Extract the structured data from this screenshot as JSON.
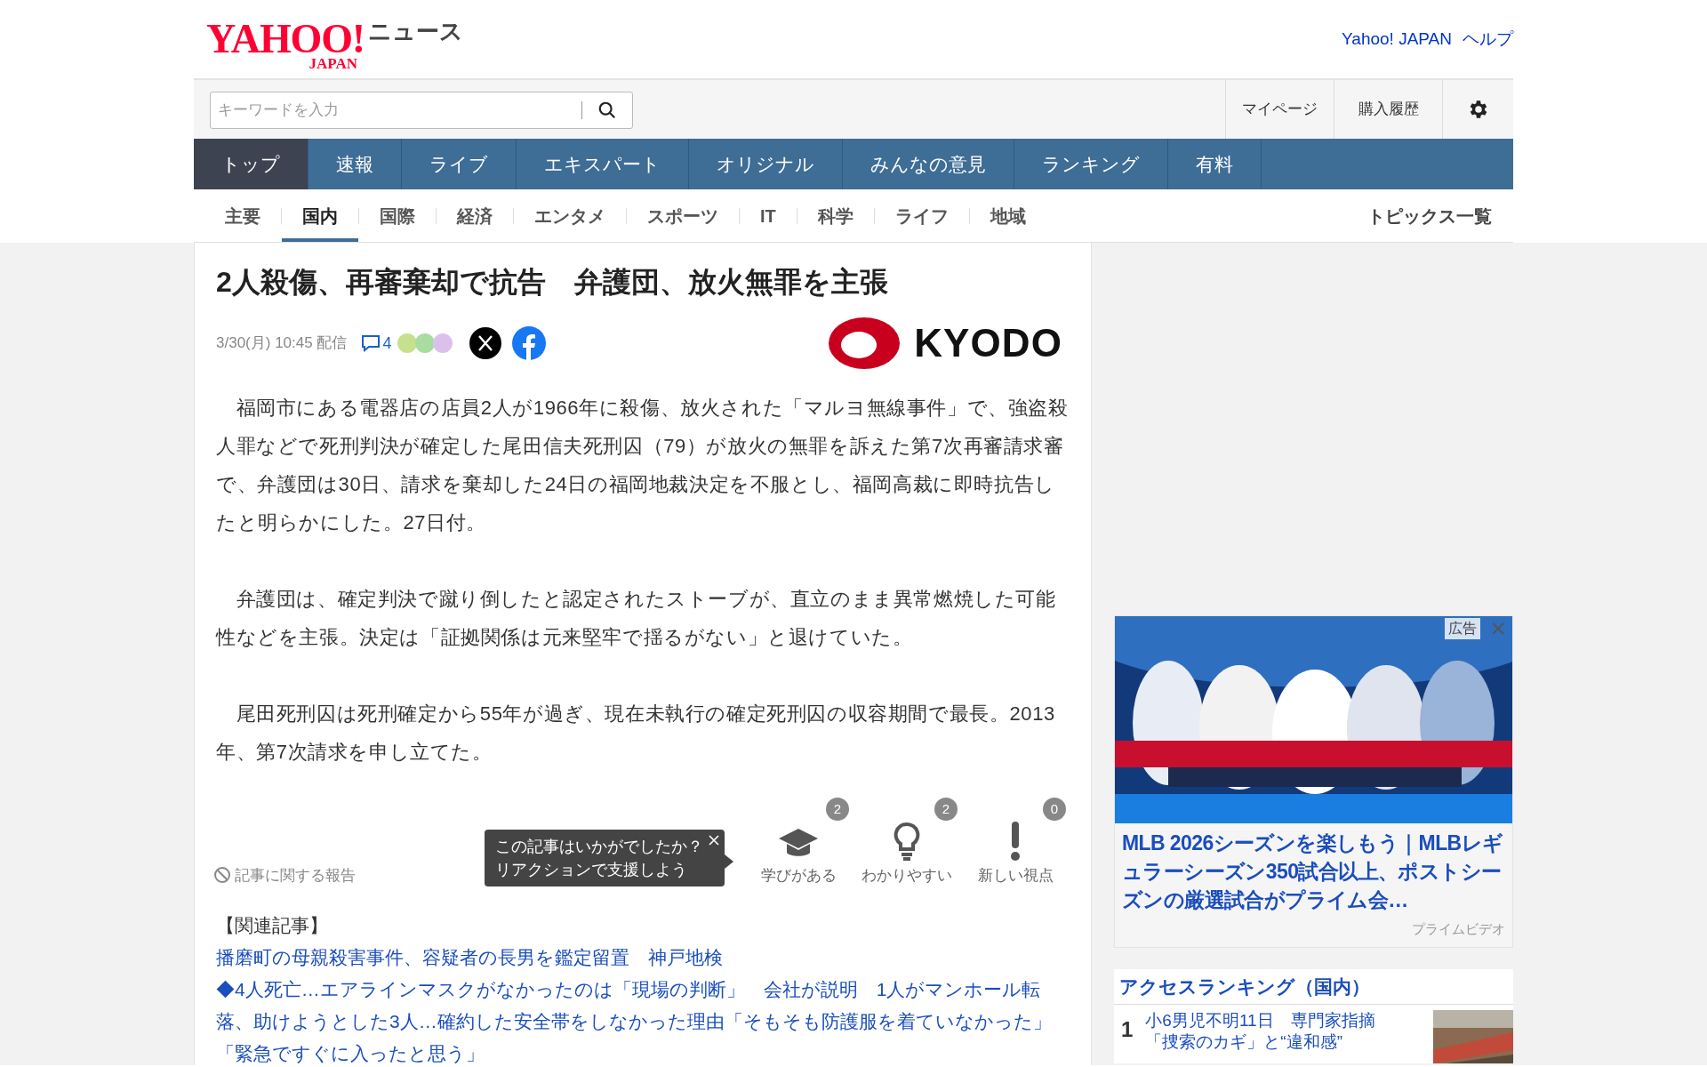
{
  "header": {
    "logo": {
      "brand": "YAHOO!",
      "sub": "JAPAN",
      "service": "ニュース"
    },
    "links": [
      "Yahoo! JAPAN",
      "ヘルプ"
    ]
  },
  "search": {
    "placeholder": "キーワードを入力"
  },
  "user_links": [
    "マイページ",
    "購入履歴"
  ],
  "main_nav": [
    {
      "label": "トップ",
      "selected": true
    },
    {
      "label": "速報",
      "selected": false
    },
    {
      "label": "ライブ",
      "selected": false
    },
    {
      "label": "エキスパート",
      "selected": false
    },
    {
      "label": "オリジナル",
      "selected": false
    },
    {
      "label": "みんなの意見",
      "selected": false
    },
    {
      "label": "ランキング",
      "selected": false
    },
    {
      "label": "有料",
      "selected": false
    }
  ],
  "sub_nav": [
    {
      "label": "主要",
      "selected": false
    },
    {
      "label": "国内",
      "selected": true
    },
    {
      "label": "国際",
      "selected": false
    },
    {
      "label": "経済",
      "selected": false
    },
    {
      "label": "エンタメ",
      "selected": false
    },
    {
      "label": "スポーツ",
      "selected": false
    },
    {
      "label": "IT",
      "selected": false
    },
    {
      "label": "科学",
      "selected": false
    },
    {
      "label": "ライフ",
      "selected": false
    },
    {
      "label": "地域",
      "selected": false
    }
  ],
  "topics_link": "トピックス一覧",
  "article": {
    "title": "2人殺傷、再審棄却で抗告　弁護団、放火無罪を主張",
    "date": "3/30(月) 10:45 配信",
    "comment_count": "4",
    "source": "KYODO",
    "paragraphs": [
      "　福岡市にある電器店の店員2人が1966年に殺傷、放火された「マルヨ無線事件」で、強盗殺人罪などで死刑判決が確定した尾田信夫死刑囚（79）が放火の無罪を訴えた第7次再審請求審で、弁護団は30日、請求を棄却した24日の福岡地裁決定を不服とし、福岡高裁に即時抗告したと明らかにした。27日付。",
      "　弁護団は、確定判決で蹴り倒したと認定されたストーブが、直立のまま異常燃焼した可能性などを主張。決定は「証拠関係は元来堅牢で揺るがない」と退けていた。",
      "　尾田死刑囚は死刑確定から55年が過ぎ、現在未執行の確定死刑囚の収容期間で最長。2013年、第7次請求を申し立てた。"
    ],
    "report_link": "記事に関する報告",
    "tooltip": [
      "この記事はいかがでしたか？",
      "リアクションで支援しよう"
    ],
    "reactions": [
      {
        "kind": "learn",
        "label": "学びがある",
        "count": "2"
      },
      {
        "kind": "clear",
        "label": "わかりやすい",
        "count": "2"
      },
      {
        "kind": "new",
        "label": "新しい視点",
        "count": "0"
      }
    ],
    "related_heading": "【関連記事】",
    "related": [
      "播磨町の母親殺害事件、容疑者の長男を鑑定留置　神戸地検",
      "◆4人死亡…エアラインマスクがなかったのは「現場の判断」　会社が説明　1人がマンホール転落、助けようとした3人…確約した安全帯をしなかった理由「そもそも防護服を着ていなかった」「緊急ですぐに入ったと思う」"
    ]
  },
  "ad": {
    "label": "広告",
    "title": "MLB 2026シーズンを楽しもう｜MLBレギュラーシーズン350試合以上、ポストシーズンの厳選試合がプライム会…",
    "sponsor": "プライムビデオ"
  },
  "ranking": {
    "title": "アクセスランキング（国内）",
    "items": [
      {
        "rank": "1",
        "lines": [
          "小6男児不明11日　専門家指摘",
          "「捜索のカギ」と“違和感”"
        ]
      }
    ]
  }
}
